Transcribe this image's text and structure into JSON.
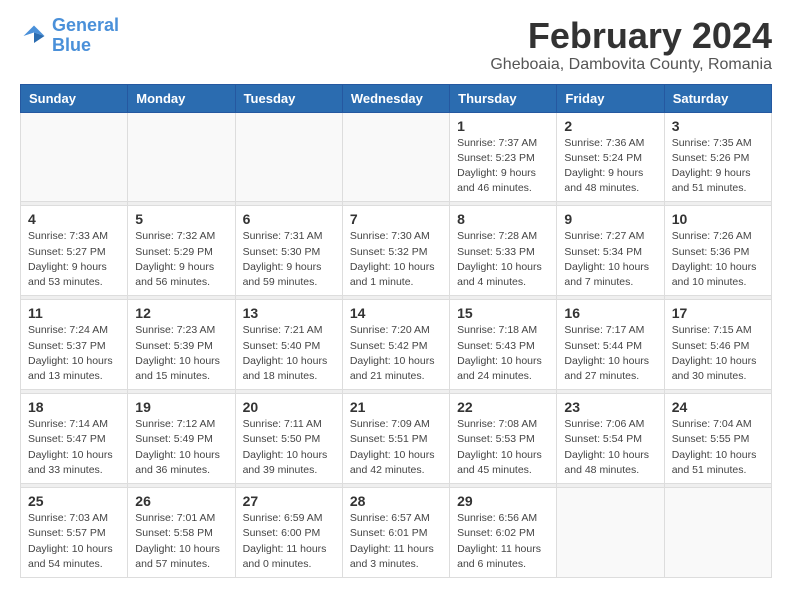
{
  "logo": {
    "line1": "General",
    "line2": "Blue"
  },
  "title": "February 2024",
  "subtitle": "Gheboaia, Dambovita County, Romania",
  "days_header": [
    "Sunday",
    "Monday",
    "Tuesday",
    "Wednesday",
    "Thursday",
    "Friday",
    "Saturday"
  ],
  "weeks": [
    [
      {
        "day": "",
        "info": ""
      },
      {
        "day": "",
        "info": ""
      },
      {
        "day": "",
        "info": ""
      },
      {
        "day": "",
        "info": ""
      },
      {
        "day": "1",
        "info": "Sunrise: 7:37 AM\nSunset: 5:23 PM\nDaylight: 9 hours\nand 46 minutes."
      },
      {
        "day": "2",
        "info": "Sunrise: 7:36 AM\nSunset: 5:24 PM\nDaylight: 9 hours\nand 48 minutes."
      },
      {
        "day": "3",
        "info": "Sunrise: 7:35 AM\nSunset: 5:26 PM\nDaylight: 9 hours\nand 51 minutes."
      }
    ],
    [
      {
        "day": "4",
        "info": "Sunrise: 7:33 AM\nSunset: 5:27 PM\nDaylight: 9 hours\nand 53 minutes."
      },
      {
        "day": "5",
        "info": "Sunrise: 7:32 AM\nSunset: 5:29 PM\nDaylight: 9 hours\nand 56 minutes."
      },
      {
        "day": "6",
        "info": "Sunrise: 7:31 AM\nSunset: 5:30 PM\nDaylight: 9 hours\nand 59 minutes."
      },
      {
        "day": "7",
        "info": "Sunrise: 7:30 AM\nSunset: 5:32 PM\nDaylight: 10 hours\nand 1 minute."
      },
      {
        "day": "8",
        "info": "Sunrise: 7:28 AM\nSunset: 5:33 PM\nDaylight: 10 hours\nand 4 minutes."
      },
      {
        "day": "9",
        "info": "Sunrise: 7:27 AM\nSunset: 5:34 PM\nDaylight: 10 hours\nand 7 minutes."
      },
      {
        "day": "10",
        "info": "Sunrise: 7:26 AM\nSunset: 5:36 PM\nDaylight: 10 hours\nand 10 minutes."
      }
    ],
    [
      {
        "day": "11",
        "info": "Sunrise: 7:24 AM\nSunset: 5:37 PM\nDaylight: 10 hours\nand 13 minutes."
      },
      {
        "day": "12",
        "info": "Sunrise: 7:23 AM\nSunset: 5:39 PM\nDaylight: 10 hours\nand 15 minutes."
      },
      {
        "day": "13",
        "info": "Sunrise: 7:21 AM\nSunset: 5:40 PM\nDaylight: 10 hours\nand 18 minutes."
      },
      {
        "day": "14",
        "info": "Sunrise: 7:20 AM\nSunset: 5:42 PM\nDaylight: 10 hours\nand 21 minutes."
      },
      {
        "day": "15",
        "info": "Sunrise: 7:18 AM\nSunset: 5:43 PM\nDaylight: 10 hours\nand 24 minutes."
      },
      {
        "day": "16",
        "info": "Sunrise: 7:17 AM\nSunset: 5:44 PM\nDaylight: 10 hours\nand 27 minutes."
      },
      {
        "day": "17",
        "info": "Sunrise: 7:15 AM\nSunset: 5:46 PM\nDaylight: 10 hours\nand 30 minutes."
      }
    ],
    [
      {
        "day": "18",
        "info": "Sunrise: 7:14 AM\nSunset: 5:47 PM\nDaylight: 10 hours\nand 33 minutes."
      },
      {
        "day": "19",
        "info": "Sunrise: 7:12 AM\nSunset: 5:49 PM\nDaylight: 10 hours\nand 36 minutes."
      },
      {
        "day": "20",
        "info": "Sunrise: 7:11 AM\nSunset: 5:50 PM\nDaylight: 10 hours\nand 39 minutes."
      },
      {
        "day": "21",
        "info": "Sunrise: 7:09 AM\nSunset: 5:51 PM\nDaylight: 10 hours\nand 42 minutes."
      },
      {
        "day": "22",
        "info": "Sunrise: 7:08 AM\nSunset: 5:53 PM\nDaylight: 10 hours\nand 45 minutes."
      },
      {
        "day": "23",
        "info": "Sunrise: 7:06 AM\nSunset: 5:54 PM\nDaylight: 10 hours\nand 48 minutes."
      },
      {
        "day": "24",
        "info": "Sunrise: 7:04 AM\nSunset: 5:55 PM\nDaylight: 10 hours\nand 51 minutes."
      }
    ],
    [
      {
        "day": "25",
        "info": "Sunrise: 7:03 AM\nSunset: 5:57 PM\nDaylight: 10 hours\nand 54 minutes."
      },
      {
        "day": "26",
        "info": "Sunrise: 7:01 AM\nSunset: 5:58 PM\nDaylight: 10 hours\nand 57 minutes."
      },
      {
        "day": "27",
        "info": "Sunrise: 6:59 AM\nSunset: 6:00 PM\nDaylight: 11 hours\nand 0 minutes."
      },
      {
        "day": "28",
        "info": "Sunrise: 6:57 AM\nSunset: 6:01 PM\nDaylight: 11 hours\nand 3 minutes."
      },
      {
        "day": "29",
        "info": "Sunrise: 6:56 AM\nSunset: 6:02 PM\nDaylight: 11 hours\nand 6 minutes."
      },
      {
        "day": "",
        "info": ""
      },
      {
        "day": "",
        "info": ""
      }
    ]
  ]
}
